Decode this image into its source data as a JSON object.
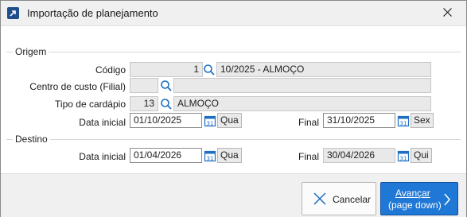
{
  "window": {
    "title": "Importação de planejamento"
  },
  "origem": {
    "label": "Origem",
    "codigo": {
      "label": "Código",
      "value": "1",
      "description": "10/2025 - ALMOÇO"
    },
    "centro": {
      "label": "Centro de custo (Filial)",
      "value": "",
      "description": ""
    },
    "cardapio": {
      "label": "Tipo de cardápio",
      "value": "13",
      "description": "ALMOÇO"
    },
    "data_inicial": {
      "label": "Data inicial",
      "value": "01/10/2025",
      "weekday": "Qua"
    },
    "final": {
      "label": "Final",
      "value": "31/10/2025",
      "weekday": "Sex"
    }
  },
  "destino": {
    "label": "Destino",
    "data_inicial": {
      "label": "Data inicial",
      "value": "01/04/2026",
      "weekday": "Qua"
    },
    "final": {
      "label": "Final",
      "value": "30/04/2026",
      "weekday": "Qui"
    }
  },
  "buttons": {
    "cancel": "Cancelar",
    "next_line1": "Avançar",
    "next_line2": "(page down)"
  },
  "icons": {
    "app": "app-arrow-icon",
    "close": "close-icon",
    "search": "search-icon",
    "calendar": "calendar-icon",
    "cancel": "x-icon",
    "next": "chevron-right-icon"
  },
  "colors": {
    "primary": "#1f77d6",
    "icon_blue": "#1e6fc4"
  }
}
